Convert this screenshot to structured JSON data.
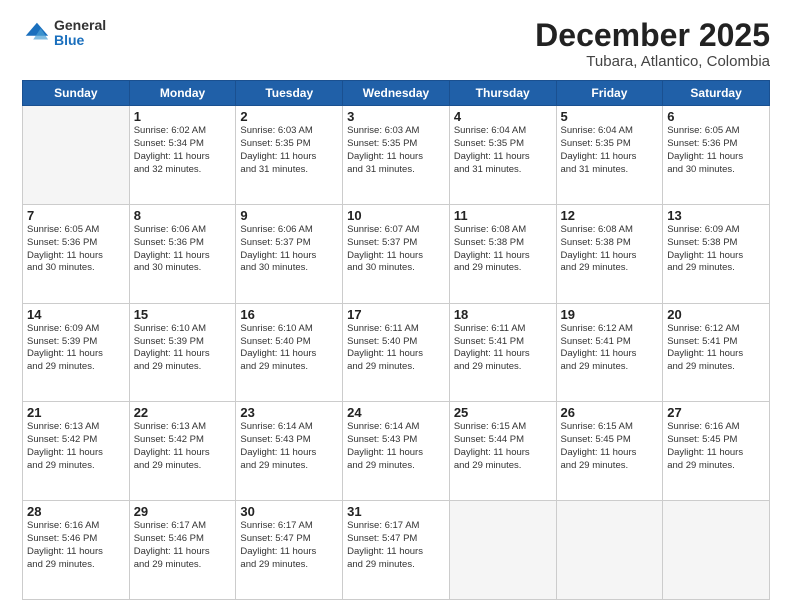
{
  "header": {
    "logo": {
      "general": "General",
      "blue": "Blue"
    },
    "title": "December 2025",
    "location": "Tubara, Atlantico, Colombia"
  },
  "weekdays": [
    "Sunday",
    "Monday",
    "Tuesday",
    "Wednesday",
    "Thursday",
    "Friday",
    "Saturday"
  ],
  "weeks": [
    [
      {
        "day": "",
        "info": ""
      },
      {
        "day": "1",
        "info": "Sunrise: 6:02 AM\nSunset: 5:34 PM\nDaylight: 11 hours\nand 32 minutes."
      },
      {
        "day": "2",
        "info": "Sunrise: 6:03 AM\nSunset: 5:35 PM\nDaylight: 11 hours\nand 31 minutes."
      },
      {
        "day": "3",
        "info": "Sunrise: 6:03 AM\nSunset: 5:35 PM\nDaylight: 11 hours\nand 31 minutes."
      },
      {
        "day": "4",
        "info": "Sunrise: 6:04 AM\nSunset: 5:35 PM\nDaylight: 11 hours\nand 31 minutes."
      },
      {
        "day": "5",
        "info": "Sunrise: 6:04 AM\nSunset: 5:35 PM\nDaylight: 11 hours\nand 31 minutes."
      },
      {
        "day": "6",
        "info": "Sunrise: 6:05 AM\nSunset: 5:36 PM\nDaylight: 11 hours\nand 30 minutes."
      }
    ],
    [
      {
        "day": "7",
        "info": "Sunrise: 6:05 AM\nSunset: 5:36 PM\nDaylight: 11 hours\nand 30 minutes."
      },
      {
        "day": "8",
        "info": "Sunrise: 6:06 AM\nSunset: 5:36 PM\nDaylight: 11 hours\nand 30 minutes."
      },
      {
        "day": "9",
        "info": "Sunrise: 6:06 AM\nSunset: 5:37 PM\nDaylight: 11 hours\nand 30 minutes."
      },
      {
        "day": "10",
        "info": "Sunrise: 6:07 AM\nSunset: 5:37 PM\nDaylight: 11 hours\nand 30 minutes."
      },
      {
        "day": "11",
        "info": "Sunrise: 6:08 AM\nSunset: 5:38 PM\nDaylight: 11 hours\nand 29 minutes."
      },
      {
        "day": "12",
        "info": "Sunrise: 6:08 AM\nSunset: 5:38 PM\nDaylight: 11 hours\nand 29 minutes."
      },
      {
        "day": "13",
        "info": "Sunrise: 6:09 AM\nSunset: 5:38 PM\nDaylight: 11 hours\nand 29 minutes."
      }
    ],
    [
      {
        "day": "14",
        "info": "Sunrise: 6:09 AM\nSunset: 5:39 PM\nDaylight: 11 hours\nand 29 minutes."
      },
      {
        "day": "15",
        "info": "Sunrise: 6:10 AM\nSunset: 5:39 PM\nDaylight: 11 hours\nand 29 minutes."
      },
      {
        "day": "16",
        "info": "Sunrise: 6:10 AM\nSunset: 5:40 PM\nDaylight: 11 hours\nand 29 minutes."
      },
      {
        "day": "17",
        "info": "Sunrise: 6:11 AM\nSunset: 5:40 PM\nDaylight: 11 hours\nand 29 minutes."
      },
      {
        "day": "18",
        "info": "Sunrise: 6:11 AM\nSunset: 5:41 PM\nDaylight: 11 hours\nand 29 minutes."
      },
      {
        "day": "19",
        "info": "Sunrise: 6:12 AM\nSunset: 5:41 PM\nDaylight: 11 hours\nand 29 minutes."
      },
      {
        "day": "20",
        "info": "Sunrise: 6:12 AM\nSunset: 5:41 PM\nDaylight: 11 hours\nand 29 minutes."
      }
    ],
    [
      {
        "day": "21",
        "info": "Sunrise: 6:13 AM\nSunset: 5:42 PM\nDaylight: 11 hours\nand 29 minutes."
      },
      {
        "day": "22",
        "info": "Sunrise: 6:13 AM\nSunset: 5:42 PM\nDaylight: 11 hours\nand 29 minutes."
      },
      {
        "day": "23",
        "info": "Sunrise: 6:14 AM\nSunset: 5:43 PM\nDaylight: 11 hours\nand 29 minutes."
      },
      {
        "day": "24",
        "info": "Sunrise: 6:14 AM\nSunset: 5:43 PM\nDaylight: 11 hours\nand 29 minutes."
      },
      {
        "day": "25",
        "info": "Sunrise: 6:15 AM\nSunset: 5:44 PM\nDaylight: 11 hours\nand 29 minutes."
      },
      {
        "day": "26",
        "info": "Sunrise: 6:15 AM\nSunset: 5:45 PM\nDaylight: 11 hours\nand 29 minutes."
      },
      {
        "day": "27",
        "info": "Sunrise: 6:16 AM\nSunset: 5:45 PM\nDaylight: 11 hours\nand 29 minutes."
      }
    ],
    [
      {
        "day": "28",
        "info": "Sunrise: 6:16 AM\nSunset: 5:46 PM\nDaylight: 11 hours\nand 29 minutes."
      },
      {
        "day": "29",
        "info": "Sunrise: 6:17 AM\nSunset: 5:46 PM\nDaylight: 11 hours\nand 29 minutes."
      },
      {
        "day": "30",
        "info": "Sunrise: 6:17 AM\nSunset: 5:47 PM\nDaylight: 11 hours\nand 29 minutes."
      },
      {
        "day": "31",
        "info": "Sunrise: 6:17 AM\nSunset: 5:47 PM\nDaylight: 11 hours\nand 29 minutes."
      },
      {
        "day": "",
        "info": ""
      },
      {
        "day": "",
        "info": ""
      },
      {
        "day": "",
        "info": ""
      }
    ]
  ]
}
